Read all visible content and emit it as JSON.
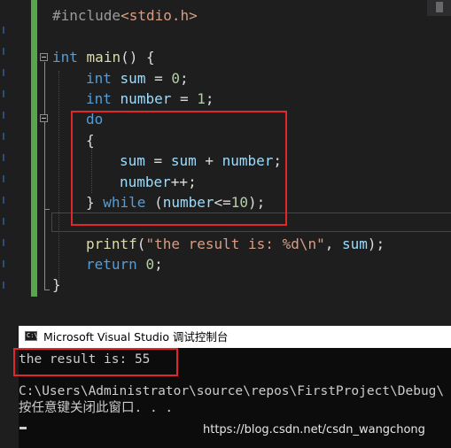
{
  "editor": {
    "lines": {
      "l1": {
        "pp": "#include",
        "inc": "<stdio.h>"
      },
      "l3": {
        "kw": "int",
        "fn": "main",
        "rest": "() {"
      },
      "l4": {
        "kw": "int",
        "id": "sum",
        "eq": " = ",
        "num": "0",
        "end": ";"
      },
      "l5": {
        "kw": "int",
        "id": "number",
        "eq": " = ",
        "num": "1",
        "end": ";"
      },
      "l6": {
        "kw": "do"
      },
      "l7": {
        "text": "{"
      },
      "l8": {
        "id1": "sum",
        "op1": " = ",
        "id2": "sum",
        "op2": " + ",
        "id3": "number",
        "end": ";"
      },
      "l9": {
        "id": "number",
        "op": "++;"
      },
      "l10": {
        "brace": "} ",
        "kw": "while",
        "open": " (",
        "id": "number",
        "op": "<=",
        "num": "10",
        "end": ");"
      },
      "l12": {
        "fn": "printf",
        "open": "(",
        "str": "\"the result is: %d\\n\"",
        "comma": ", ",
        "id": "sum",
        "end": ");"
      },
      "l13": {
        "kw": "return",
        "sp": " ",
        "num": "0",
        "end": ";"
      },
      "l14": {
        "text": "}"
      }
    }
  },
  "console": {
    "title": "Microsoft Visual Studio 调试控制台",
    "icon_label": "C:\\",
    "output": "the result is: 55",
    "path_line": "C:\\Users\\Administrator\\source\\repos\\FirstProject\\Debug\\",
    "press_key": "按任意键关闭此窗口. . ."
  },
  "watermark": "https://blog.csdn.net/csdn_wangchong",
  "colors": {
    "keyword": "#569cd6",
    "identifier": "#9cdcfe",
    "number": "#b5cea8",
    "string": "#d69d85",
    "highlight_box": "#e0282c",
    "change_bar": "#57a64a"
  }
}
